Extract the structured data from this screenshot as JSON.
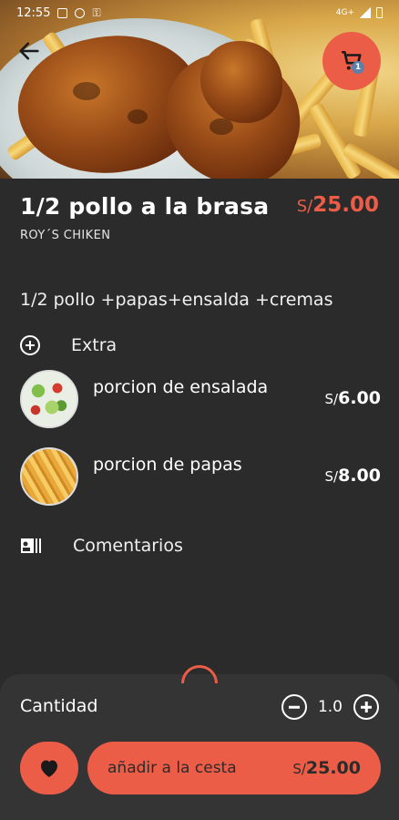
{
  "status_bar": {
    "time": "12:55",
    "network": "4G+"
  },
  "header": {
    "cart_count": "1"
  },
  "product": {
    "title": "1/2 pollo a la brasa",
    "brand": "ROY´S CHIKEN",
    "price_currency": "S/",
    "price_amount": "25.00",
    "description": "1/2 pollo +papas+ensalda +cremas"
  },
  "extras": {
    "label": "Extra",
    "items": [
      {
        "name": "porcion de ensalada",
        "currency": "S/",
        "amount": "6.00"
      },
      {
        "name": "porcion de papas",
        "currency": "S/",
        "amount": "8.00"
      }
    ]
  },
  "comments": {
    "label": "Comentarios"
  },
  "footer": {
    "quantity_label": "Cantidad",
    "quantity_value": "1.0",
    "add_label": "añadir a la cesta",
    "total_currency": "S/",
    "total_amount": "25.00"
  },
  "colors": {
    "accent": "#ec5d48",
    "background": "#2b2b2b",
    "sheet": "#343434"
  }
}
